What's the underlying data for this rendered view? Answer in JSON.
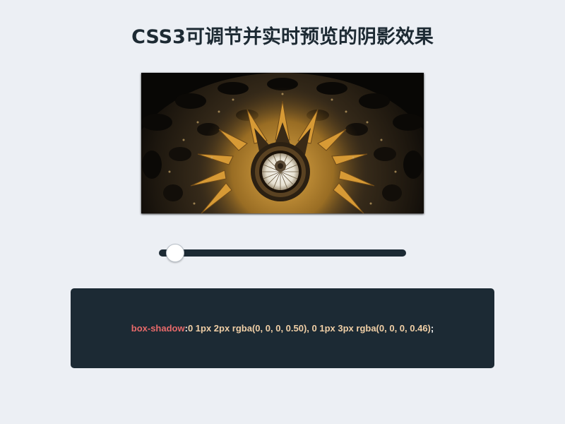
{
  "page": {
    "title": "CSS3可调节并实时预览的阴影效果"
  },
  "preview": {
    "image": "dome-ceiling-photo"
  },
  "slider": {
    "value_fraction": 0.03
  },
  "code": {
    "property": "box-shadow",
    "separator": " : ",
    "value": "0 1px 2px rgba(0, 0, 0, 0.50), 0 1px 3px rgba(0, 0, 0, 0.46)",
    "terminator": " ;"
  },
  "colors": {
    "background": "#ECEFF4",
    "dark_panel": "#1C2A34",
    "property_color": "#E86A6A",
    "value_color": "#F0CFA6"
  }
}
